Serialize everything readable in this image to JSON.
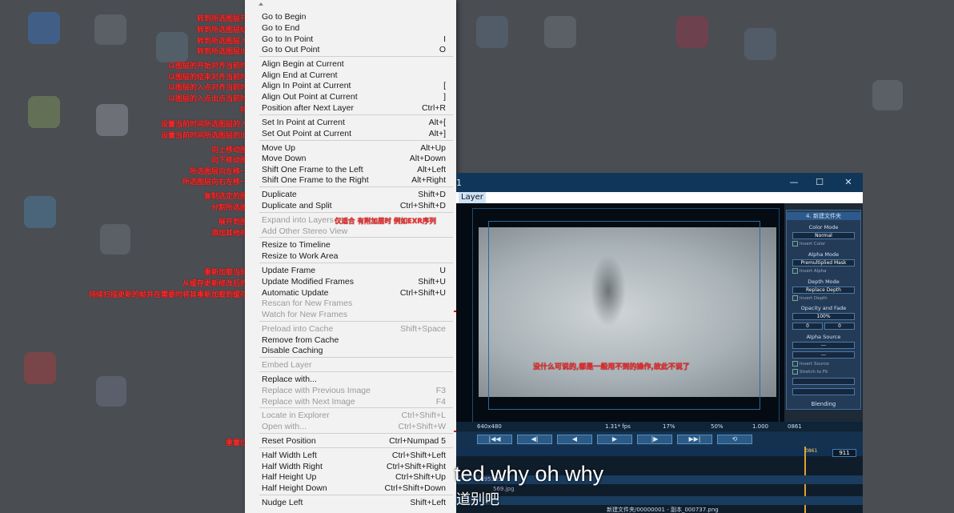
{
  "menu": {
    "items": [
      {
        "label": "Go to Begin",
        "shortcut": "",
        "disabled": false,
        "note": "转到所选图层开始"
      },
      {
        "label": "Go to End",
        "shortcut": "",
        "disabled": false,
        "note": "转到所选图层结束"
      },
      {
        "label": "Go to In Point",
        "shortcut": "I",
        "disabled": false,
        "note": "转到所选图层入点"
      },
      {
        "label": "Go to Out Point",
        "shortcut": "O",
        "disabled": false,
        "note": "转到所选图层出点"
      },
      {
        "label": "Align Begin at Current",
        "shortcut": "",
        "disabled": false,
        "note": "以图层的开始对齐当前时间"
      },
      {
        "label": "Align End at Current",
        "shortcut": "",
        "disabled": false,
        "note": "以图层的结束对齐当前时间"
      },
      {
        "label": "Align In Point at Current",
        "shortcut": "[",
        "disabled": false,
        "note": "以图层的入点对齐当前时间"
      },
      {
        "label": "Align Out Point at Current",
        "shortcut": "]",
        "disabled": false,
        "note": "以图层的入点出点当前时间"
      },
      {
        "label": "Position after Next Layer",
        "shortcut": "Ctrl+R",
        "disabled": false,
        "note": "排列"
      },
      {
        "label": "Set In Point at Current",
        "shortcut": "Alt+[",
        "disabled": false,
        "note": "设置当前时间所选图层的入点"
      },
      {
        "label": "Set Out Point at Current",
        "shortcut": "Alt+]",
        "disabled": false,
        "note": "设置当前时间所选图层的出点"
      },
      {
        "label": "Move Up",
        "shortcut": "Alt+Up",
        "disabled": false,
        "note": "向上移动图层"
      },
      {
        "label": "Move Down",
        "shortcut": "Alt+Down",
        "disabled": false,
        "note": "向下移动图层"
      },
      {
        "label": "Shift One Frame to the Left",
        "shortcut": "Alt+Left",
        "disabled": false,
        "note": "所选图层向左移一帧"
      },
      {
        "label": "Shift One Frame to the Right",
        "shortcut": "Alt+Right",
        "disabled": false,
        "note": "所选图层向右左移一帧"
      },
      {
        "label": "Duplicate",
        "shortcut": "Shift+D",
        "disabled": false,
        "note": "复制选定的图层"
      },
      {
        "label": "Duplicate and Split",
        "shortcut": "Ctrl+Shift+D",
        "disabled": false,
        "note": "分割所选图层"
      },
      {
        "label": "Expand into Layers",
        "shortcut": "",
        "disabled": true,
        "note": "展开到图层"
      },
      {
        "label": "Add Other Stereo View",
        "shortcut": "",
        "disabled": true,
        "note": "添加其他视图"
      },
      {
        "label": "Resize to Timeline",
        "shortcut": "",
        "disabled": false,
        "note": ""
      },
      {
        "label": "Resize to Work Area",
        "shortcut": "",
        "disabled": false,
        "note": ""
      },
      {
        "label": "Update Frame",
        "shortcut": "U",
        "disabled": false,
        "note": "重新加载当前帧"
      },
      {
        "label": "Update Modified Frames",
        "shortcut": "Shift+U",
        "disabled": false,
        "note": "从缓存更新修改后的帧"
      },
      {
        "label": "Automatic Update",
        "shortcut": "Ctrl+Shift+U",
        "disabled": false,
        "note": "持续扫描更新的帧并在需要时将其重新加载到缓存中"
      },
      {
        "label": "Rescan for New Frames",
        "shortcut": "",
        "disabled": true,
        "note": ""
      },
      {
        "label": "Watch for New Frames",
        "shortcut": "",
        "disabled": true,
        "note": ""
      },
      {
        "label": "Preload into Cache",
        "shortcut": "Shift+Space",
        "disabled": true,
        "note": ""
      },
      {
        "label": "Remove from Cache",
        "shortcut": "",
        "disabled": false,
        "note": ""
      },
      {
        "label": "Disable Caching",
        "shortcut": "",
        "disabled": false,
        "note": ""
      },
      {
        "label": "Embed Layer",
        "shortcut": "",
        "disabled": true,
        "note": ""
      },
      {
        "label": "Replace with...",
        "shortcut": "",
        "disabled": false,
        "note": ""
      },
      {
        "label": "Replace with Previous Image",
        "shortcut": "F3",
        "disabled": true,
        "note": ""
      },
      {
        "label": "Replace with Next Image",
        "shortcut": "F4",
        "disabled": true,
        "note": ""
      },
      {
        "label": "Locate in Explorer",
        "shortcut": "Ctrl+Shift+L",
        "disabled": true,
        "note": ""
      },
      {
        "label": "Open with...",
        "shortcut": "Ctrl+Shift+W",
        "disabled": true,
        "note": ""
      },
      {
        "label": "Reset Position",
        "shortcut": "Ctrl+Numpad 5",
        "disabled": false,
        "note": "重置位置"
      },
      {
        "label": "Half Width Left",
        "shortcut": "Ctrl+Shift+Left",
        "disabled": false,
        "note": ""
      },
      {
        "label": "Half Width Right",
        "shortcut": "Ctrl+Shift+Right",
        "disabled": false,
        "note": ""
      },
      {
        "label": "Half Height Up",
        "shortcut": "Ctrl+Shift+Up",
        "disabled": false,
        "note": ""
      },
      {
        "label": "Half Height Down",
        "shortcut": "Ctrl+Shift+Down",
        "disabled": false,
        "note": ""
      },
      {
        "label": "Nudge Left",
        "shortcut": "Shift+Left",
        "disabled": false,
        "note": ""
      }
    ]
  },
  "annotations": {
    "expand_note": "仅适合 有附加层时 例如EXR序列",
    "bracket_note": "没什么可说的,都是一般用不到的操作,故此不说了"
  },
  "window": {
    "title_suffix": "1",
    "menubar_item": "Layer",
    "minimize_glyph": "—",
    "maximize_glyph": "☐",
    "close_glyph": "✕",
    "panel": {
      "title": "4. 新建文件夹",
      "color_mode_label": "Color Mode",
      "color_mode_value": "Normal",
      "invert_color": "Invert Color",
      "alpha_mode_label": "Alpha Mode",
      "alpha_mode_value": "Premultiplied Mask",
      "invert_alpha": "Invert Alpha",
      "depth_mode_label": "Depth Mode",
      "depth_mode_value": "Replace Depth",
      "invert_depth": "Invert Depth",
      "opacity_label": "Opacity and Fade",
      "opacity_value": "100%",
      "fade_in": "0",
      "fade_out": "0",
      "alpha_source_label": "Alpha Source",
      "alpha_source_value": "---",
      "alpha_source_value2": "---",
      "invert_source": "Invert Source",
      "stretch_to_fit": "Stretch to Fit",
      "blending_label": "Blending"
    },
    "status": {
      "resolution": "640x480",
      "fps": "1.31* fps",
      "zoom1": "17%",
      "zoom2": "50%",
      "ratio": "1.000",
      "frame": "0861"
    },
    "timeline": {
      "current_frame": "861",
      "end_frame": "911",
      "frame_marker": "0861",
      "clip_label1": "695385",
      "clip_label2": "569.jpg",
      "clip_label3": "新建文件夹/00000001 - 副本_000737.png"
    }
  },
  "subtitles": {
    "line1": "ted why oh why",
    "line2": "道别吧"
  }
}
